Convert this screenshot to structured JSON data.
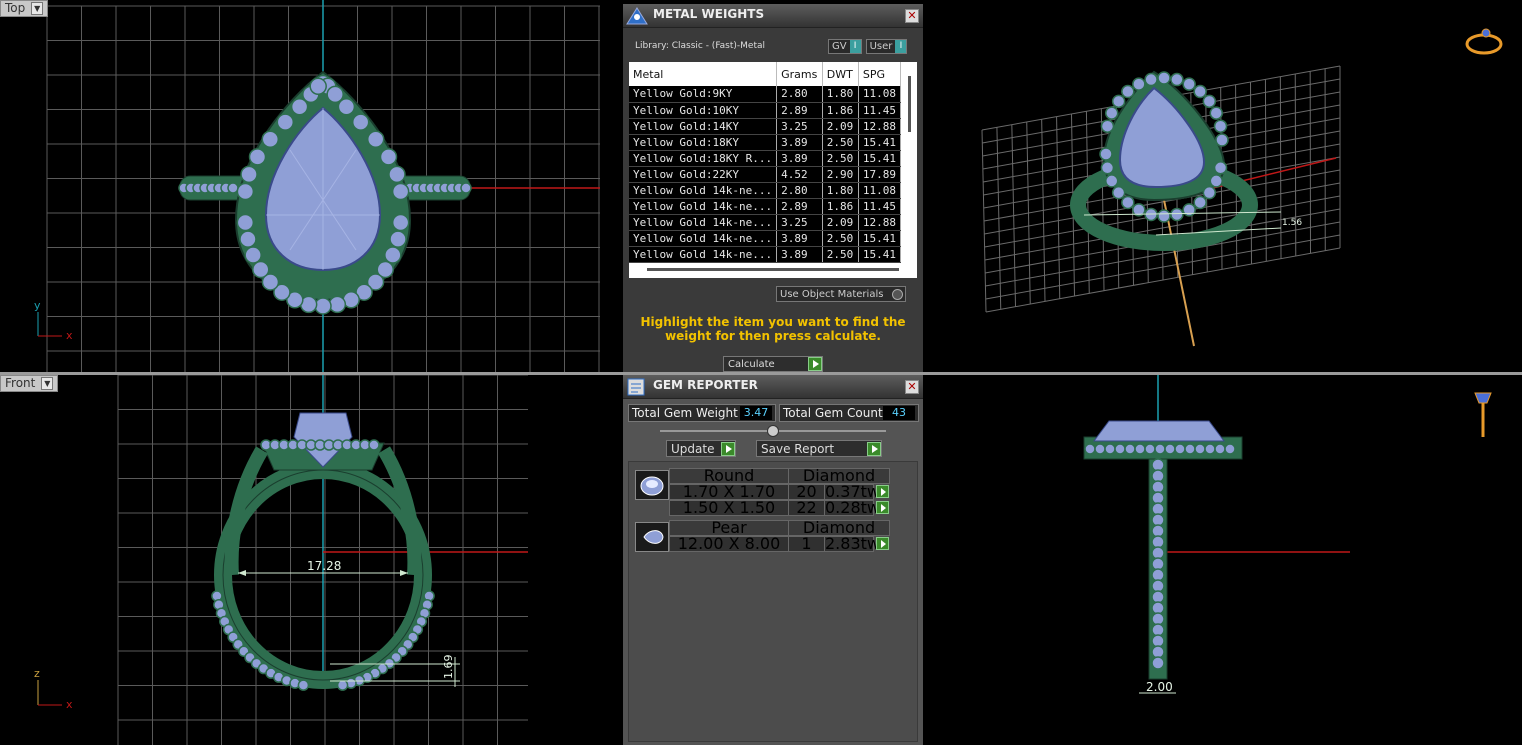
{
  "viewports": {
    "top_left": {
      "label": "Top"
    },
    "bottom_left": {
      "label": "Front"
    },
    "top_right": {
      "label": ""
    },
    "bottom_right": {
      "label": ""
    },
    "axes": {
      "y": "y",
      "x": "x",
      "z": "z"
    },
    "dimensions": {
      "ring_size": "17.28",
      "band_height": "1.69",
      "shank_width": "2.00",
      "side_note": "1.56"
    }
  },
  "metal_weights": {
    "title": "METAL WEIGHTS",
    "library": "Library: Classic - (Fast)-Metal",
    "toggle_gv": "GV",
    "toggle_user": "User",
    "columns": [
      "Metal",
      "Grams",
      "DWT",
      "SPG"
    ],
    "rows": [
      [
        "Yellow Gold:9KY",
        "2.80",
        "1.80",
        "11.08"
      ],
      [
        "Yellow Gold:10KY",
        "2.89",
        "1.86",
        "11.45"
      ],
      [
        "Yellow Gold:14KY",
        "3.25",
        "2.09",
        "12.88"
      ],
      [
        "Yellow Gold:18KY",
        "3.89",
        "2.50",
        "15.41"
      ],
      [
        "Yellow Gold:18KY R...",
        "3.89",
        "2.50",
        "15.41"
      ],
      [
        "Yellow Gold:22KY",
        "4.52",
        "2.90",
        "17.89"
      ],
      [
        "Yellow Gold 14k-ne...",
        "2.80",
        "1.80",
        "11.08"
      ],
      [
        "Yellow Gold 14k-ne...",
        "2.89",
        "1.86",
        "11.45"
      ],
      [
        "Yellow Gold 14k-ne...",
        "3.25",
        "2.09",
        "12.88"
      ],
      [
        "Yellow Gold 14k-ne...",
        "3.89",
        "2.50",
        "15.41"
      ],
      [
        "Yellow Gold 14k-ne...",
        "3.89",
        "2.50",
        "15.41"
      ]
    ],
    "use_object_materials": "Use Object Materials",
    "hint": "Highlight the item you want to find the weight for then press calculate.",
    "calculate": "Calculate"
  },
  "gem_reporter": {
    "title": "GEM REPORTER",
    "total_weight_label": "Total Gem Weight",
    "total_weight": "3.47",
    "total_count_label": "Total Gem Count",
    "total_count": "43",
    "update": "Update",
    "save_report": "Save Report",
    "groups": [
      {
        "cut": "Round",
        "type": "Diamond",
        "rows": [
          {
            "size": "1.70 X 1.70",
            "count": "20",
            "weight": "0.37tw"
          },
          {
            "size": "1.50 X 1.50",
            "count": "22",
            "weight": "0.28tw"
          }
        ]
      },
      {
        "cut": "Pear",
        "type": "Diamond",
        "rows": [
          {
            "size": "12.00 X 8.00",
            "count": "1",
            "weight": "2.83tw"
          }
        ]
      }
    ]
  },
  "colors": {
    "metal": "#2e6e4f",
    "gem": "#8f9fd6",
    "grid": "#5a5a5a",
    "x_axis": "#c01818",
    "y_axis": "#1aa0b0",
    "hint": "#f2c200"
  }
}
